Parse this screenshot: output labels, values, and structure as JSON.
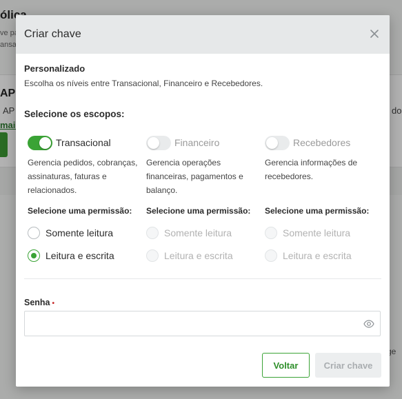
{
  "background": {
    "title": "ólica",
    "subtitle_line1": "ve pa",
    "subtitle_line2": "ansa",
    "card_title": "API",
    "card_line": "AP",
    "card_link": "mais",
    "right_text1": "do",
    "right_text2": "ge"
  },
  "modal": {
    "title": "Criar chave",
    "close_icon": "close-icon",
    "section_title": "Personalizado",
    "section_desc": "Escolha os níveis entre Transacional, Financeiro e Recebedores.",
    "scopes_title": "Selecione os escopos:",
    "scopes": [
      {
        "label": "Transacional",
        "enabled": true,
        "description": "Gerencia pedidos, cobranças, assinaturas, faturas e relacionados.",
        "perm_title": "Selecione uma permissão:",
        "options": [
          "Somente leitura",
          "Leitura e escrita"
        ],
        "selected": "Leitura e escrita"
      },
      {
        "label": "Financeiro",
        "enabled": false,
        "description": "Gerencia operações financeiras, pagamentos e balanço.",
        "perm_title": "Selecione uma permissão:",
        "options": [
          "Somente leitura",
          "Leitura e escrita"
        ],
        "selected": ""
      },
      {
        "label": "Recebedores",
        "enabled": false,
        "description": "Gerencia informações de recebedores.",
        "perm_title": "Selecione uma permissão:",
        "options": [
          "Somente leitura",
          "Leitura e escrita"
        ],
        "selected": ""
      }
    ],
    "password": {
      "label": "Senha",
      "required_mark": "•",
      "value": "",
      "placeholder": "",
      "icon": "eye-icon"
    },
    "buttons": {
      "back": "Voltar",
      "create": "Criar chave"
    }
  },
  "colors": {
    "accent": "#3aa335",
    "header_bg": "#e6e8e9",
    "required": "#c62828"
  }
}
